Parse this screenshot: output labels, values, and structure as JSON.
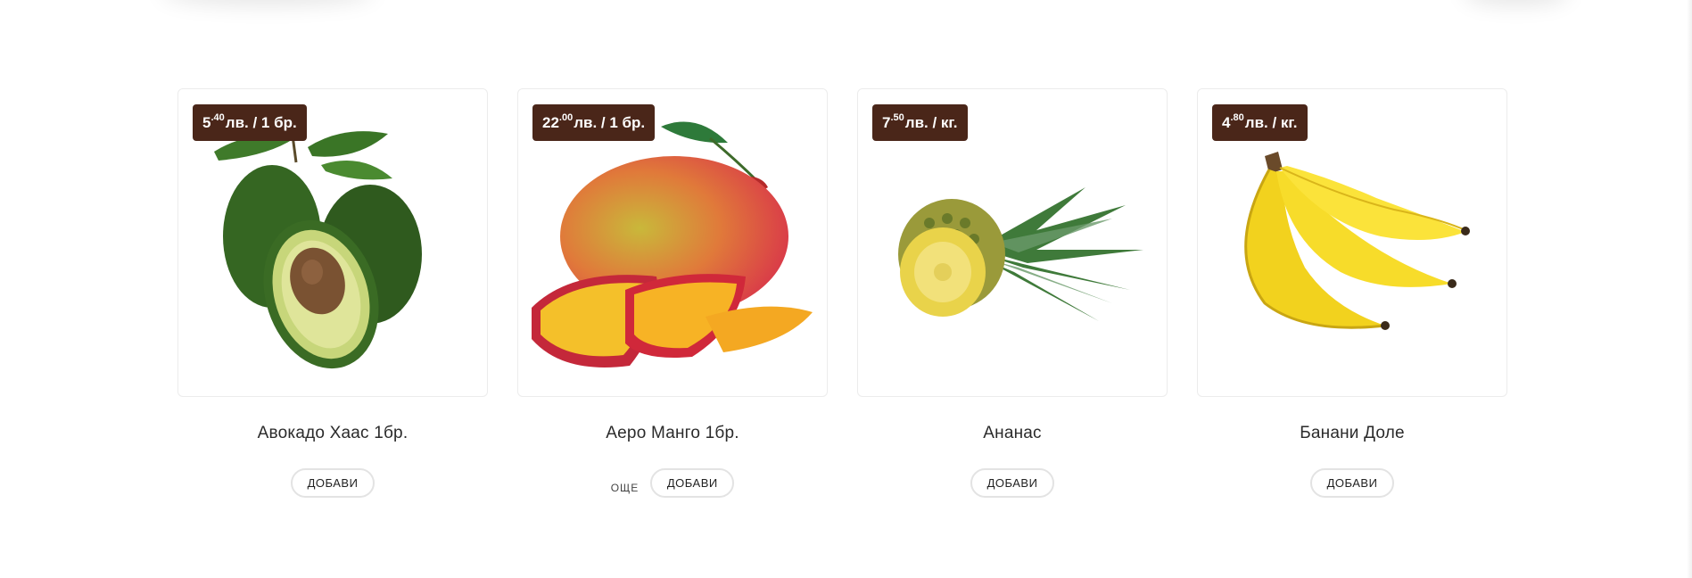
{
  "products": [
    {
      "name": "Авокадо Хаас 1бр.",
      "price": {
        "int": "5",
        "dec": "40",
        "unit": "лв. / 1 бр."
      },
      "image_icon": "avocado-image",
      "add_label": "ДОБАВИ",
      "more_label": ""
    },
    {
      "name": "Аеро Манго 1бр.",
      "price": {
        "int": "22",
        "dec": "00",
        "unit": "лв. / 1 бр."
      },
      "image_icon": "mango-image",
      "add_label": "ДОБАВИ",
      "more_label": "ОЩЕ"
    },
    {
      "name": "Ананас",
      "price": {
        "int": "7",
        "dec": "50",
        "unit": "лв. / кг."
      },
      "image_icon": "pineapple-image",
      "add_label": "ДОБАВИ",
      "more_label": ""
    },
    {
      "name": "Банани Доле",
      "price": {
        "int": "4",
        "dec": "80",
        "unit": "лв. / кг."
      },
      "image_icon": "bananas-image",
      "add_label": "ДОБАВИ",
      "more_label": ""
    }
  ],
  "colors": {
    "badge": "#4a2619",
    "button_border": "#e3e3e3",
    "text": "#2b2b2b"
  }
}
